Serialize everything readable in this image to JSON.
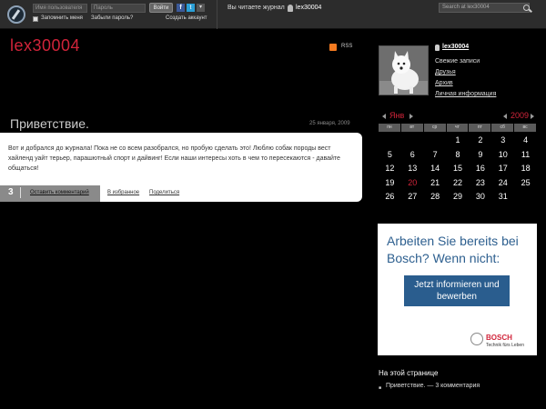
{
  "topbar": {
    "username_placeholder": "Имя пользователя",
    "password_placeholder": "Пароль",
    "login_label": "Войти",
    "remember_label": "Запомнить меня",
    "forgot_label": "Забыли пароль?",
    "create_label": "Создать аккаунт",
    "facebook_letter": "f",
    "twitter_letter": "t",
    "more_glyph": "▾",
    "reading_label": "Вы читаете журнал",
    "reading_user": "lex30004",
    "search_placeholder": "Search at lex30004"
  },
  "journal": {
    "title": "lex30004",
    "rss_label": "RSS"
  },
  "post": {
    "title": "Приветствие.",
    "date": "25 января, 2009",
    "body": "Вот и добрался до журнала! Пока не со всем разобрался, но пробую сделать это! Люблю собак породы вест хайленд уайт терьер, парашютный спорт и дайвинг! Если наши интересы хоть в чем то пересекаются - давайте общаться!",
    "comment_count": "3",
    "leave_comment_label": "Оставить комментарий",
    "favorites_label": "В избранное",
    "share_label": "Поделиться"
  },
  "profile": {
    "username": "lex30004",
    "links": [
      "Свежие записи",
      "Друзья",
      "Архив",
      "Личная информация"
    ]
  },
  "calendar": {
    "month": "Янв",
    "year": "2009",
    "weekdays": [
      "пн",
      "вт",
      "ср",
      "чт",
      "пт",
      "сб",
      "вс"
    ],
    "days": [
      "",
      "",
      "",
      "1",
      "2",
      "3",
      "4",
      "5",
      "6",
      "7",
      "8",
      "9",
      "10",
      "11",
      "12",
      "13",
      "14",
      "15",
      "16",
      "17",
      "18",
      "19",
      "20",
      "21",
      "22",
      "23",
      "24",
      "25",
      "26",
      "27",
      "28",
      "29",
      "30",
      "31",
      ""
    ],
    "highlight_day": "20"
  },
  "ad": {
    "headline": "Arbeiten Sie bereits bei Bosch? Wenn nicht:",
    "button_label": "Jetzt informieren und bewerben",
    "brand": "BOSCH",
    "slogan": "Technik fürs Leben"
  },
  "on_this_page": {
    "title": "На этой странице",
    "items": [
      "Приветствие. — 3 комментария"
    ]
  },
  "colors": {
    "accent_red": "#d1243a",
    "ad_blue": "#2a5d8e"
  }
}
